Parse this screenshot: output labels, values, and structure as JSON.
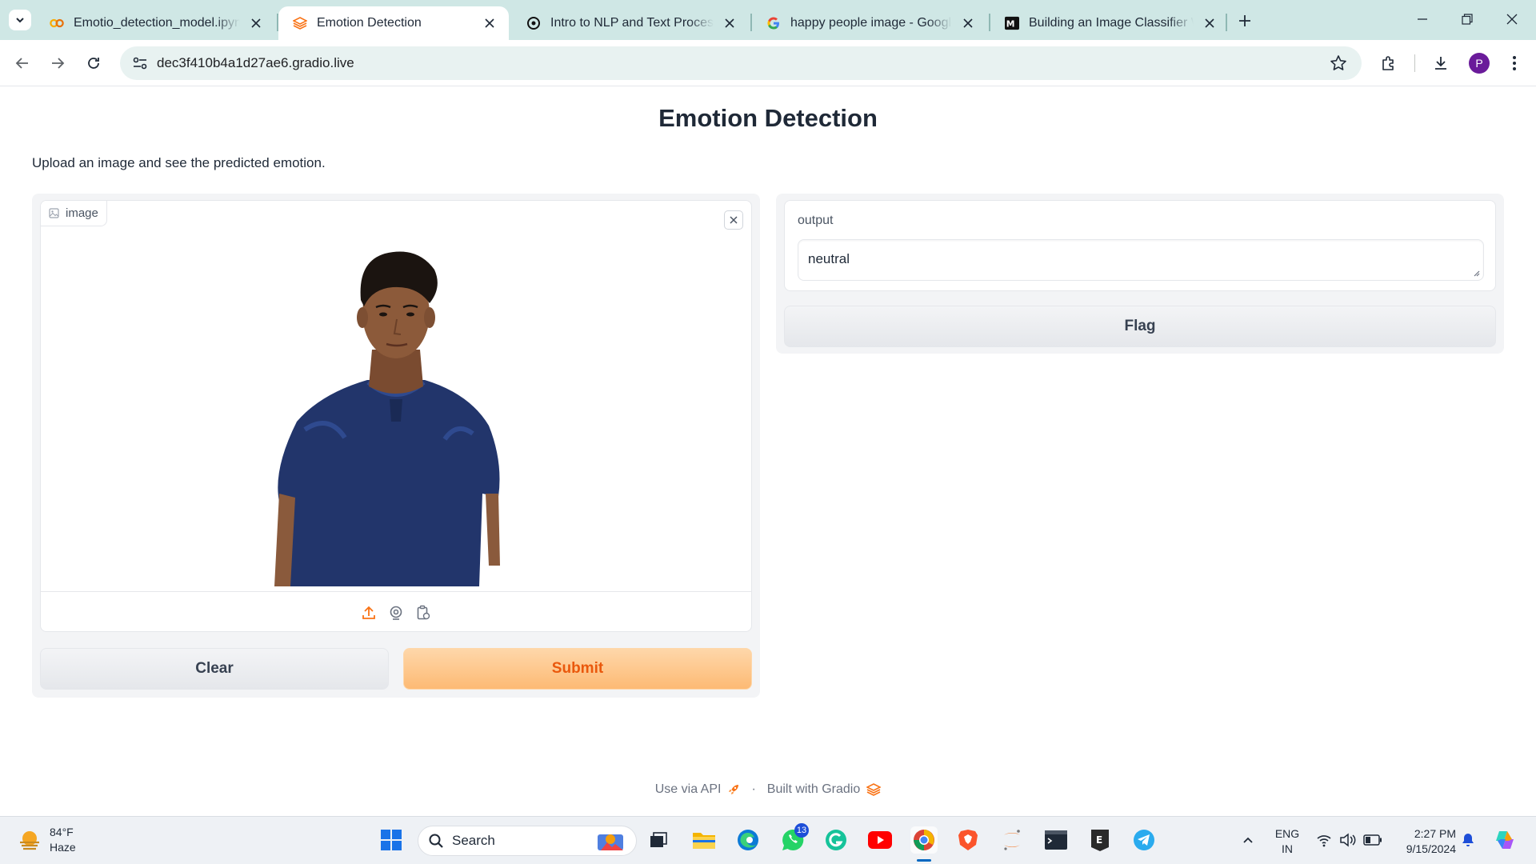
{
  "browser": {
    "tabs": [
      {
        "title": "Emotio_detection_model.ipynb",
        "icon": "colab-icon",
        "active": false
      },
      {
        "title": "Emotion Detection",
        "icon": "gradio-icon",
        "active": true
      },
      {
        "title": "Intro to NLP and Text Processing",
        "icon": "chatgpt-icon",
        "active": false
      },
      {
        "title": "happy people image - Google Search",
        "icon": "google-icon",
        "active": false
      },
      {
        "title": "Building an Image Classifier Web",
        "icon": "medium-icon",
        "active": false
      }
    ],
    "url": "dec3f410b4a1d27ae6.gradio.live",
    "profile_initial": "P"
  },
  "app": {
    "title": "Emotion Detection",
    "description": "Upload an image and see the predicted emotion.",
    "image_input": {
      "label": "image"
    },
    "clear_label": "Clear",
    "submit_label": "Submit",
    "output": {
      "label": "output",
      "value": "neutral"
    },
    "flag_label": "Flag",
    "footer": {
      "api_label": "Use via API",
      "separator": "·",
      "built_label": "Built with Gradio"
    }
  },
  "taskbar": {
    "weather_temp": "84°F",
    "weather_desc": "Haze",
    "search_label": "Search",
    "whatsapp_badge": "13",
    "lang_top": "ENG",
    "lang_bottom": "IN",
    "time": "2:27 PM",
    "date": "9/15/2024"
  },
  "colors": {
    "accent": "#ea580c",
    "tabbar": "#cfe7e5",
    "submit_bg": "#fdba74"
  }
}
